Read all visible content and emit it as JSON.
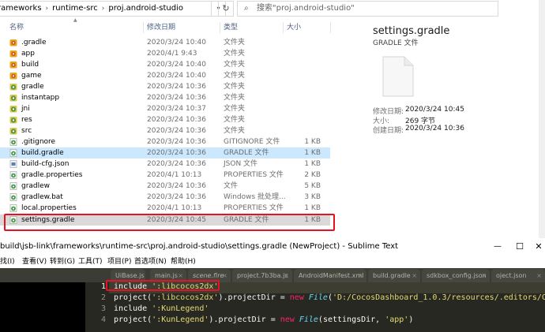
{
  "explorer": {
    "breadcrumb": [
      "rameworks",
      "runtime-src",
      "proj.android-studio"
    ],
    "search_placeholder": "搜索\"proj.android-studio\"",
    "columns": {
      "name": "名称",
      "date": "修改日期",
      "type": "类型",
      "size": "大小"
    },
    "files": [
      {
        "name": ".gradle",
        "date": "2020/3/24 10:40",
        "type": "文件夹",
        "size": "",
        "icon": "folder-app-icon"
      },
      {
        "name": "app",
        "date": "2020/4/1 9:43",
        "type": "文件夹",
        "size": "",
        "icon": "folder-app-icon"
      },
      {
        "name": "build",
        "date": "2020/3/24 10:40",
        "type": "文件夹",
        "size": "",
        "icon": "folder-app-icon"
      },
      {
        "name": "game",
        "date": "2020/3/24 10:40",
        "type": "文件夹",
        "size": "",
        "icon": "folder-app-icon"
      },
      {
        "name": "gradle",
        "date": "2020/3/24 10:36",
        "type": "文件夹",
        "size": "",
        "icon": "folder-gradle-icon"
      },
      {
        "name": "instantapp",
        "date": "2020/3/24 10:36",
        "type": "文件夹",
        "size": "",
        "icon": "folder-gradle-icon"
      },
      {
        "name": "jni",
        "date": "2020/3/24 10:37",
        "type": "文件夹",
        "size": "",
        "icon": "folder-gradle-icon"
      },
      {
        "name": "res",
        "date": "2020/3/24 10:36",
        "type": "文件夹",
        "size": "",
        "icon": "folder-gradle-icon"
      },
      {
        "name": "src",
        "date": "2020/3/24 10:36",
        "type": "文件夹",
        "size": "",
        "icon": "folder-gradle-icon"
      },
      {
        "name": ".gitignore",
        "date": "2020/3/24 10:36",
        "type": "GITIGNORE 文件",
        "size": "1 KB",
        "icon": "gradle-file-icon"
      },
      {
        "name": "build.gradle",
        "date": "2020/3/24 10:36",
        "type": "GRADLE 文件",
        "size": "1 KB",
        "icon": "gradle-file-icon"
      },
      {
        "name": "build-cfg.json",
        "date": "2020/3/24 10:36",
        "type": "JSON 文件",
        "size": "1 KB",
        "icon": "json-file-icon"
      },
      {
        "name": "gradle.properties",
        "date": "2020/4/1 10:13",
        "type": "PROPERTIES 文件",
        "size": "2 KB",
        "icon": "gradle-file-icon"
      },
      {
        "name": "gradlew",
        "date": "2020/3/24 10:36",
        "type": "文件",
        "size": "5 KB",
        "icon": "gradle-file-icon"
      },
      {
        "name": "gradlew.bat",
        "date": "2020/3/24 10:36",
        "type": "Windows 批处理...",
        "size": "3 KB",
        "icon": "gradle-file-icon"
      },
      {
        "name": "local.properties",
        "date": "2020/4/1 10:13",
        "type": "PROPERTIES 文件",
        "size": "1 KB",
        "icon": "gradle-file-icon"
      },
      {
        "name": "settings.gradle",
        "date": "2020/3/24 10:45",
        "type": "GRADLE 文件",
        "size": "1 KB",
        "icon": "gradle-file-icon"
      }
    ],
    "preview": {
      "title": "settings.gradle",
      "subtitle": "GRADLE 文件",
      "modified_label": "修改日期:",
      "modified_value": "2020/3/24 10:45",
      "size_label": "大小:",
      "size_value": "269 字节",
      "created_label": "创建日期:",
      "created_value": "2020/3/24 10:36"
    }
  },
  "sublime": {
    "title": "build\\jsb-link\\frameworks\\runtime-src\\proj.android-studio\\settings.gradle (NewProject) - Sublime Text",
    "menu": [
      "找(I)",
      "查看(V)",
      "转到(G)",
      "工具(T)",
      "项目(P)",
      "首选项(N)",
      "帮助(H)"
    ],
    "tabs": [
      "UiBase.js",
      "main.js",
      "scene.fire",
      "project.7b3ba.js",
      "AndroidManifest.xml",
      "build.gradle",
      "sdkbox_config.json",
      "oject.json"
    ],
    "line_numbers": [
      "1",
      "2",
      "3",
      "4"
    ],
    "code": {
      "l1a": "include ",
      "l1b": "':libcocos2dx'",
      "l2a": "project(",
      "l2b": "':libcocos2dx'",
      "l2c": ").projectDir = ",
      "l2d": "new",
      "l2e": " ",
      "l2f": "File",
      "l2g": "(",
      "l2h": "'D:/CocosDashboard_1.0.3/resources/.editors/Co",
      "l3a": "include ",
      "l3b": "':KunLegend'",
      "l4a": "project(",
      "l4b": "':KunLegend'",
      "l4c": ").projectDir = ",
      "l4d": "new",
      "l4e": " ",
      "l4f": "File",
      "l4g": "(settingsDir, ",
      "l4h": "'app'",
      "l4i": ")"
    }
  }
}
